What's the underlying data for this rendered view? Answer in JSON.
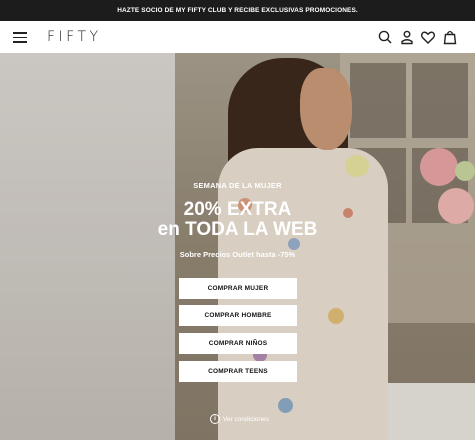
{
  "promo_bar": {
    "text": "HAZTE SOCIO DE MY FIFTY CLUB Y RECIBE EXCLUSIVAS PROMOCIONES."
  },
  "header": {
    "logo": "FIFTY",
    "icons": [
      "menu-icon",
      "search-icon",
      "user-icon",
      "heart-icon",
      "bag-icon"
    ]
  },
  "hero": {
    "eyebrow": "SEMANA DE LA MUJER",
    "title_line1": "20% EXTRA",
    "title_line2": "en TODA LA WEB",
    "subtitle": "Sobre Precios Outlet hasta -75%",
    "buttons": [
      {
        "label": "COMPRAR MUJER"
      },
      {
        "label": "COMPRAR HOMBRE"
      },
      {
        "label": "COMPRAR NIÑOS"
      },
      {
        "label": "COMPRAR TEENS"
      }
    ],
    "conditions_label": "Ver condiciones",
    "info_glyph": "i"
  },
  "colors": {
    "promo_bg": "#1c1c1c",
    "header_bg": "#ffffff",
    "cta_bg": "#ffffff",
    "hero_text": "#ffffff"
  }
}
